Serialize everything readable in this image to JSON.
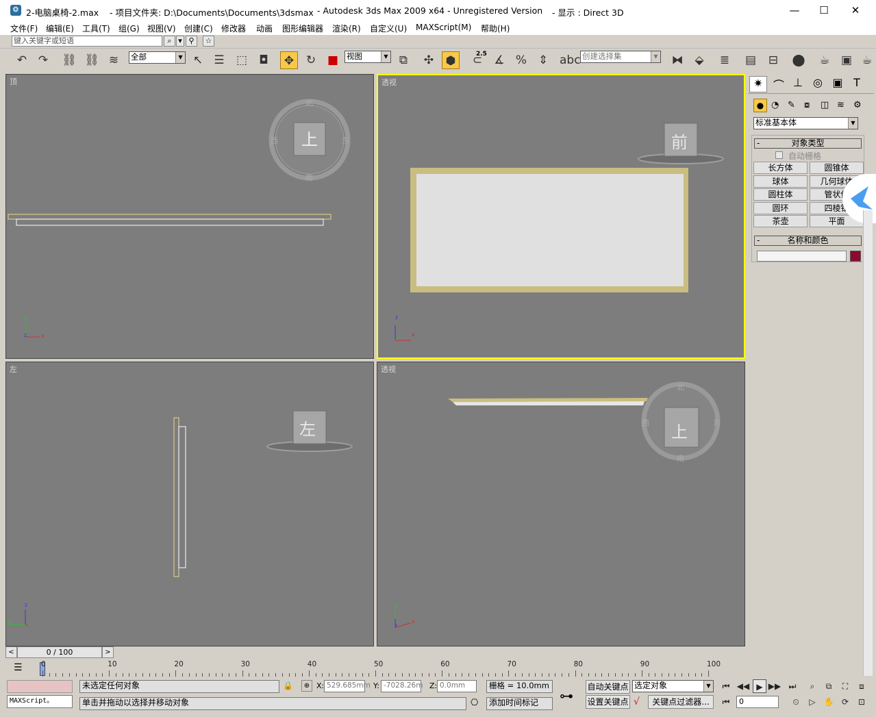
{
  "title_bar": {
    "file": "2-电脑桌椅-2.max",
    "project": "- 项目文件夹: D:\\Documents\\Documents\\3dsmax",
    "app": "- Autodesk 3ds Max  2009 x64  - Unregistered Version",
    "display": "- 显示 : Direct 3D",
    "minimize": "—",
    "maximize": "☐",
    "close": "✕"
  },
  "menu": [
    "文件(F)",
    "编辑(E)",
    "工具(T)",
    "组(G)",
    "视图(V)",
    "创建(C)",
    "修改器",
    "动画",
    "图形编辑器",
    "渲染(R)",
    "自定义(U)",
    "MAXScript(M)",
    "帮助(H)"
  ],
  "search": {
    "placeholder": "键入关键字或短语"
  },
  "toolbar": {
    "selection_filter": "全部",
    "reference_coord": "视图",
    "snap_value": "2.5",
    "named_selection": "创建选择集"
  },
  "viewports": {
    "top": {
      "label": "顶",
      "cube": "上"
    },
    "persp1": {
      "label": "透视",
      "cube": "前"
    },
    "left": {
      "label": "左",
      "cube": "左"
    },
    "persp2": {
      "label": "透视",
      "cube": "上"
    }
  },
  "compass": {
    "n": "北",
    "s": "南",
    "e": "东",
    "w": "西"
  },
  "axes": {
    "x": "x",
    "y": "y",
    "z": "z"
  },
  "command_panel": {
    "dropdown": "标准基本体",
    "object_type_title": "对象类型",
    "autogrid": "自动栅格",
    "buttons": [
      "长方体",
      "圆锥体",
      "球体",
      "几何球体",
      "圆柱体",
      "管状体",
      "圆环",
      "四棱锥",
      "茶壶",
      "平面"
    ],
    "name_color_title": "名称和颜色",
    "color": "#8b0a32"
  },
  "timeline": {
    "frame": "0 / 100",
    "ticks": [
      "0",
      "10",
      "20",
      "30",
      "40",
      "50",
      "60",
      "70",
      "80",
      "90",
      "100"
    ]
  },
  "status": {
    "maxscript": "MAXScript。",
    "selection": "未选定任何对象",
    "prompt": "单击并拖动以选择并移动对象",
    "x_label": "X:",
    "x": "529.685mm",
    "y_label": "Y:",
    "y": "-7028.26m",
    "z_label": "Z:",
    "z": "0.0mm",
    "grid": "栅格 = 10.0mm",
    "add_time_tag": "添加时间标记",
    "auto_key": "自动关键点",
    "set_key": "设置关键点",
    "key_mode": "选定对象",
    "key_filters": "关键点过滤器...",
    "current_frame": "0"
  }
}
